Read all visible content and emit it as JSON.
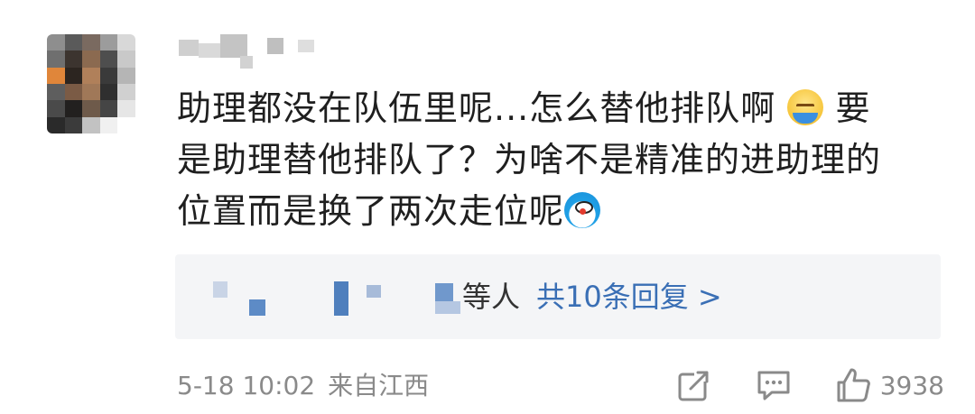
{
  "comment": {
    "avatar": {
      "mosaic_colors": [
        "#8e8e8e",
        "#5a5a5a",
        "#7a6a60",
        "#9c9c9c",
        "#d8d8d8",
        "#6f6f6f",
        "#3c342f",
        "#8b6a50",
        "#4e4e4e",
        "#c9c9c9",
        "#e0863a",
        "#2c2520",
        "#b0805a",
        "#3a3a3a",
        "#b5b5b5",
        "#5e5e5e",
        "#7b5b45",
        "#a07858",
        "#2f2f2f",
        "#d0d0d0",
        "#4a4a4a",
        "#22201f",
        "#6e5a4a",
        "#454545",
        "#e6e6e6",
        "#2a2a2a",
        "#3b3b3b",
        "#c2c2c2",
        "#f0f0f0",
        "#ffffff"
      ]
    },
    "body_line1": "助理都没在队伍里呢...怎么替他排队啊",
    "body_line1_tail": "要",
    "body_line2": "是助理替他排队了？为啥不是精准的进助理的",
    "body_line3": "位置而是换了两次走位呢",
    "emoji_1": "sweat-emoji",
    "emoji_2": "doraemon-emoji",
    "replies": {
      "etc_label": "等人",
      "count_label": "共10条回复 >",
      "count_color": "#3a6fb5"
    },
    "footer": {
      "time": "5-18 10:02",
      "source": "来自江西",
      "like_count": "3938"
    },
    "icons": {
      "repost": "repost-icon",
      "comment": "comment-icon",
      "like": "thumbs-up-icon"
    }
  }
}
